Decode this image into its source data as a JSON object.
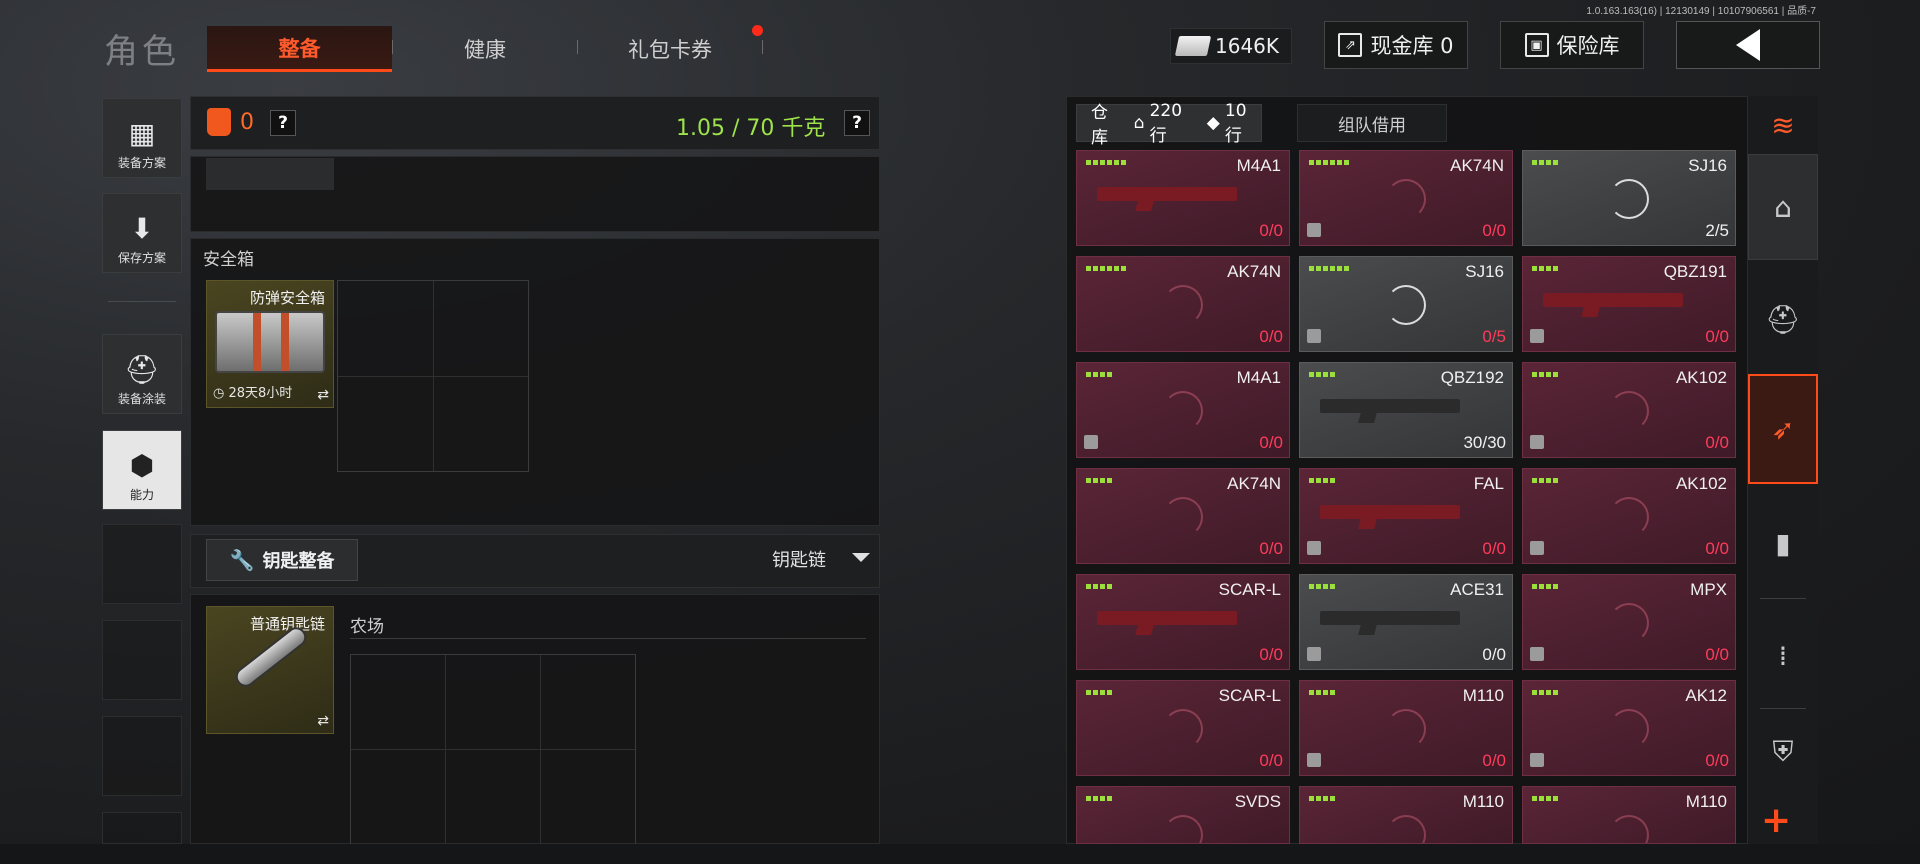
{
  "version": "1.0.163.163(16) | 12130149 | 10107906561 | 品质-7",
  "header": {
    "title": "角色",
    "tabs": [
      {
        "label": "整备",
        "active": true
      },
      {
        "label": "健康",
        "active": false
      },
      {
        "label": "礼包卡券",
        "active": false,
        "has_badge": true
      }
    ],
    "money": "1646K",
    "cash_vault": "现金库 0",
    "insurance": "保险库"
  },
  "left_rail": [
    {
      "label": "装备方案",
      "icon": "vest-icon"
    },
    {
      "label": "保存方案",
      "icon": "download-icon"
    },
    {
      "label": "装备涂装",
      "icon": "helmet-icon"
    },
    {
      "label": "能力",
      "icon": "ability-icon"
    }
  ],
  "loadout": {
    "bag_count": "0",
    "help": "?",
    "weight": "1.05 / 70 千克"
  },
  "safe_box": {
    "section_label": "安全箱",
    "item_name": "防弹安全箱",
    "timer": "28天8小时",
    "swap": "⇄"
  },
  "keys": {
    "button_label": "钥匙整备",
    "dropdown_label": "钥匙链",
    "item_name": "普通钥匙链",
    "swap": "⇄",
    "location": "农场"
  },
  "warehouse": {
    "tab_label": "仓库",
    "rows_label": "220行",
    "ticket_label": "10行",
    "team_tab": "组队借用",
    "colors": {
      "red_card": "#5a2537",
      "gray_card": "#4b4c4e",
      "bar": "#9adf3a",
      "ammo_red": "#ff3b5c"
    },
    "items": [
      {
        "name": "M4A1",
        "ammo": "0/0",
        "bars": 6,
        "style": "red",
        "has_gun": true,
        "cube": false
      },
      {
        "name": "AK74N",
        "ammo": "0/0",
        "bars": 6,
        "style": "red",
        "has_gun": false,
        "cube": true
      },
      {
        "name": "SJ16",
        "ammo": "2/5",
        "bars": 4,
        "style": "gray",
        "has_gun": false,
        "cube": false
      },
      {
        "name": "AK74N",
        "ammo": "0/0",
        "bars": 6,
        "style": "red",
        "has_gun": false,
        "cube": false
      },
      {
        "name": "SJ16",
        "ammo": "0/5",
        "bars": 6,
        "style": "gray",
        "has_gun": false,
        "cube": true
      },
      {
        "name": "QBZ191",
        "ammo": "0/0",
        "bars": 4,
        "style": "red",
        "has_gun": true,
        "cube": true
      },
      {
        "name": "M4A1",
        "ammo": "0/0",
        "bars": 4,
        "style": "red",
        "has_gun": false,
        "cube": true
      },
      {
        "name": "QBZ192",
        "ammo": "30/30",
        "bars": 4,
        "style": "gray",
        "has_gun": true,
        "cube": false
      },
      {
        "name": "AK102",
        "ammo": "0/0",
        "bars": 4,
        "style": "red",
        "has_gun": false,
        "cube": true
      },
      {
        "name": "AK74N",
        "ammo": "0/0",
        "bars": 4,
        "style": "red",
        "has_gun": false,
        "cube": false
      },
      {
        "name": "FAL",
        "ammo": "0/0",
        "bars": 4,
        "style": "red",
        "has_gun": true,
        "cube": true
      },
      {
        "name": "AK102",
        "ammo": "0/0",
        "bars": 4,
        "style": "red",
        "has_gun": false,
        "cube": true
      },
      {
        "name": "SCAR-L",
        "ammo": "0/0",
        "bars": 4,
        "style": "red",
        "has_gun": true,
        "cube": false
      },
      {
        "name": "ACE31",
        "ammo": "0/0",
        "bars": 4,
        "style": "gray",
        "has_gun": true,
        "cube": true
      },
      {
        "name": "MPX",
        "ammo": "0/0",
        "bars": 4,
        "style": "red",
        "has_gun": false,
        "cube": true
      },
      {
        "name": "SCAR-L",
        "ammo": "0/0",
        "bars": 4,
        "style": "red",
        "has_gun": false,
        "cube": false
      },
      {
        "name": "M110",
        "ammo": "0/0",
        "bars": 4,
        "style": "red",
        "has_gun": false,
        "cube": true
      },
      {
        "name": "AK12",
        "ammo": "0/0",
        "bars": 4,
        "style": "red",
        "has_gun": false,
        "cube": true
      },
      {
        "name": "SVDS",
        "ammo": "",
        "bars": 4,
        "style": "red",
        "has_gun": false,
        "cube": false
      },
      {
        "name": "M110",
        "ammo": "",
        "bars": 4,
        "style": "red",
        "has_gun": false,
        "cube": false
      },
      {
        "name": "M110",
        "ammo": "",
        "bars": 4,
        "style": "red",
        "has_gun": false,
        "cube": false
      }
    ]
  },
  "right_rail": [
    {
      "icon": "refresh-stack-icon"
    },
    {
      "icon": "home-icon"
    },
    {
      "icon": "helmet-icon"
    },
    {
      "icon": "gun-icon",
      "active": true
    },
    {
      "icon": "magazine-icon"
    },
    {
      "icon": "ammo-icon"
    },
    {
      "icon": "armor-icon"
    },
    {
      "icon": "plus-icon",
      "label": "+"
    }
  ]
}
